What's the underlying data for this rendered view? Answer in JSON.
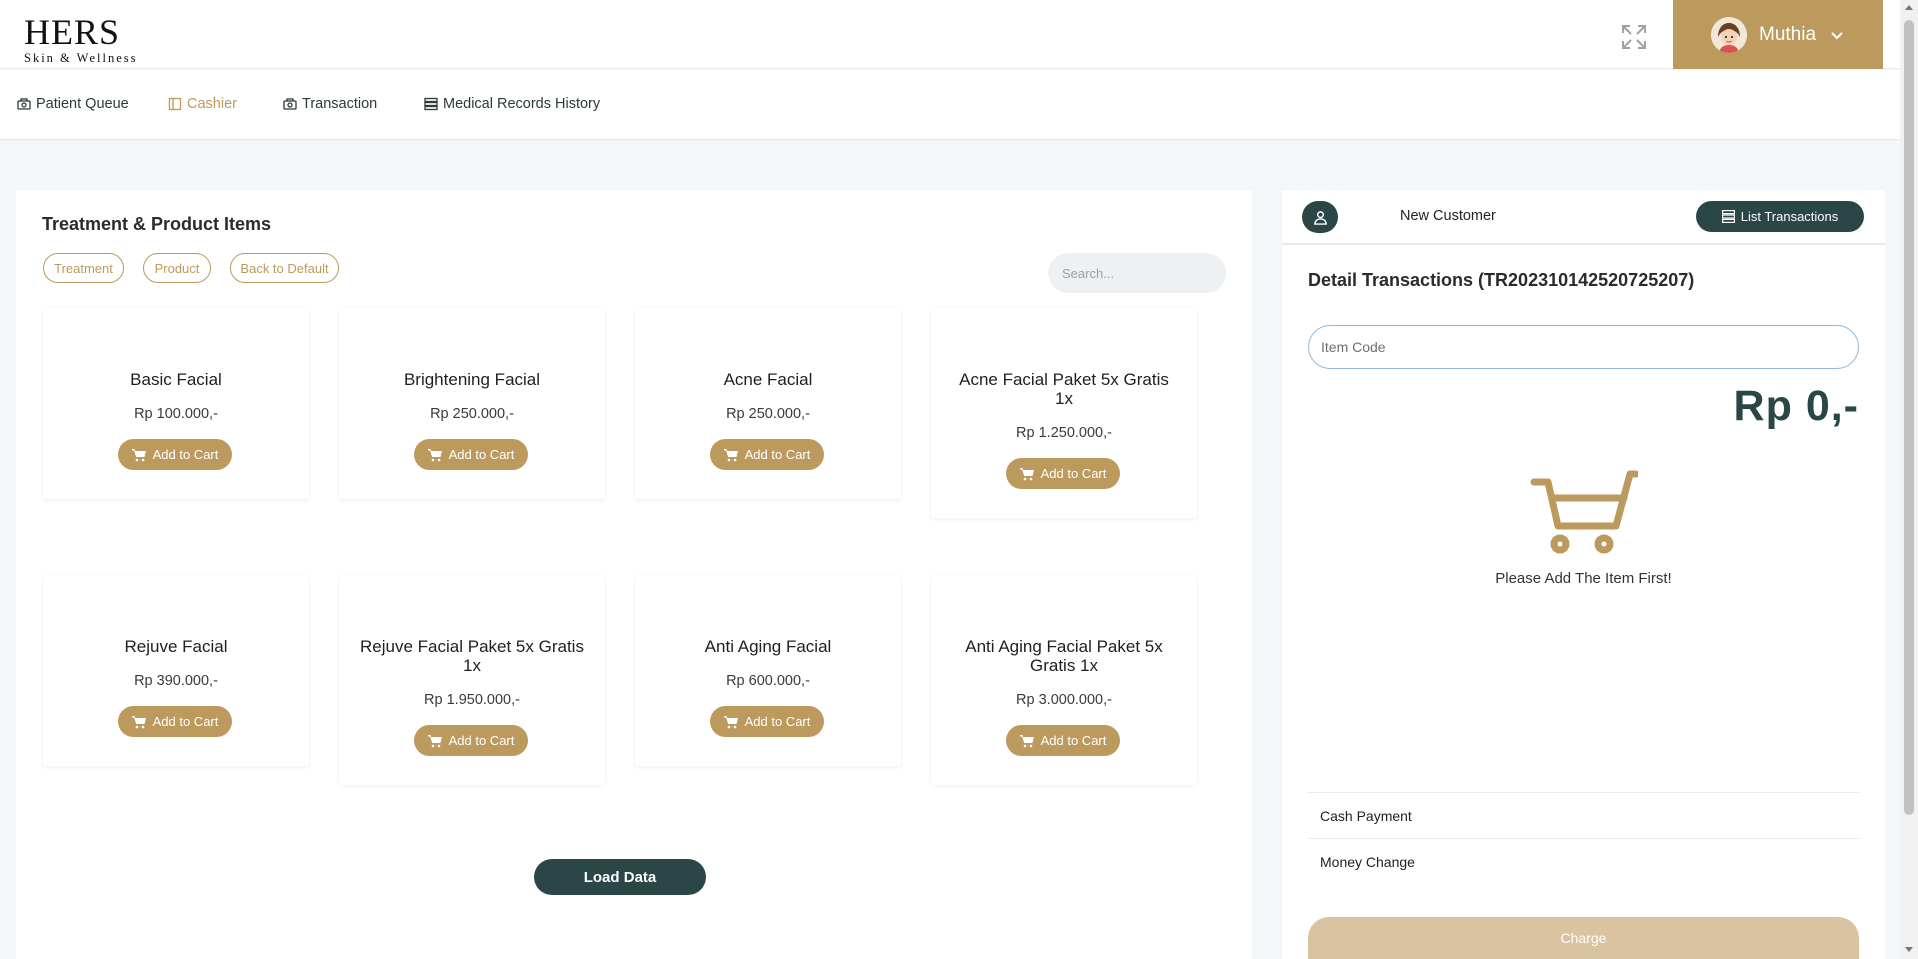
{
  "brand": {
    "name": "HERS",
    "tagline": "Skin & Wellness"
  },
  "header": {
    "expand_icon": "expand-icon",
    "user": {
      "name": "Muthia",
      "avatar_icon": "avatar"
    }
  },
  "nav": {
    "items": [
      {
        "label": "Patient Queue",
        "icon": "queue-icon",
        "active": false
      },
      {
        "label": "Cashier",
        "icon": "cashier-icon",
        "active": true
      },
      {
        "label": "Transaction",
        "icon": "transaction-icon",
        "active": false
      },
      {
        "label": "Medical Records History",
        "icon": "records-icon",
        "active": false
      }
    ]
  },
  "catalog": {
    "title": "Treatment & Product Items",
    "filters": [
      "Treatment",
      "Product",
      "Back to Default"
    ],
    "search_placeholder": "Search...",
    "add_label": "Add to Cart",
    "products": [
      {
        "name": "Basic Facial",
        "price": "Rp 100.000,-"
      },
      {
        "name": "Brightening Facial",
        "price": "Rp 250.000,-"
      },
      {
        "name": "Acne Facial",
        "price": "Rp 250.000,-"
      },
      {
        "name": "Acne Facial Paket 5x Gratis 1x",
        "price": "Rp 1.250.000,-"
      },
      {
        "name": "Rejuve Facial",
        "price": "Rp 390.000,-"
      },
      {
        "name": "Rejuve Facial Paket 5x Gratis 1x",
        "price": "Rp 1.950.000,-"
      },
      {
        "name": "Anti Aging Facial",
        "price": "Rp 600.000,-"
      },
      {
        "name": "Anti Aging Facial Paket 5x Gratis 1x",
        "price": "Rp 3.000.000,-"
      }
    ],
    "load_label": "Load Data"
  },
  "transaction": {
    "customer_label": "New Customer",
    "list_label": "List Transactions",
    "detail_title": "Detail Transactions (TR202310142520725207)",
    "item_code_placeholder": "Item Code",
    "total": "Rp 0,-",
    "empty_message": "Please Add The Item First!",
    "cash_payment_label": "Cash Payment",
    "money_change_label": "Money Change",
    "charge_label": "Charge"
  },
  "colors": {
    "gold": "#bc9a5d",
    "dark_teal": "#2a4647",
    "charge_disabled": "#d9c3a0",
    "background": "#f3f7f9"
  }
}
